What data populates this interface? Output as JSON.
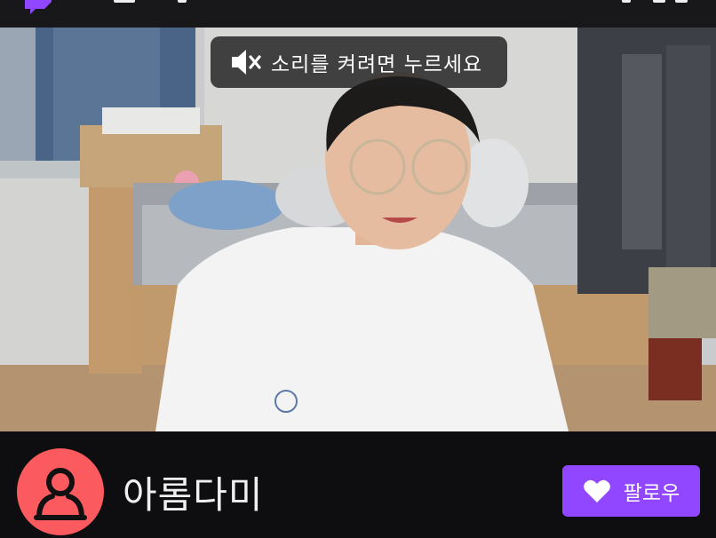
{
  "video": {
    "mute_banner_text": "소리를 켜려면 누르세요"
  },
  "channel": {
    "name": "아롬다미",
    "follow_label": "팔로우"
  },
  "colors": {
    "brand_purple": "#9147ff",
    "avatar_background": "#fb5a5f",
    "page_background": "#0e0e10"
  },
  "icons": {
    "logo": "twitch-glitch-icon",
    "mute": "speaker-muted-icon",
    "avatar": "user-silhouette-icon",
    "follow": "heart-icon"
  }
}
